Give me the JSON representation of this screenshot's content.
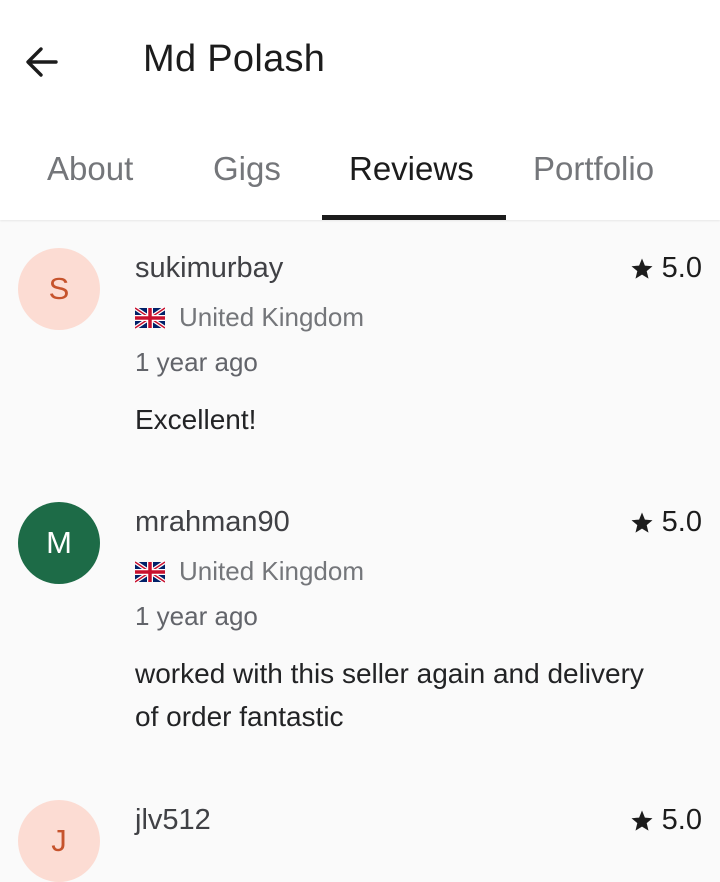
{
  "header": {
    "title": "Md Polash"
  },
  "tabs": [
    {
      "label": "About"
    },
    {
      "label": "Gigs"
    },
    {
      "label": "Reviews"
    },
    {
      "label": "Portfolio"
    }
  ],
  "active_tab": "Reviews",
  "reviews": [
    {
      "initial": "S",
      "avatar_bg": "#fcdcd3",
      "avatar_fg": "#c6532c",
      "username": "sukimurbay",
      "rating": "5.0",
      "country": "United Kingdom",
      "time": "1 year ago",
      "comment": "Excellent!"
    },
    {
      "initial": "M",
      "avatar_bg": "#1d6b47",
      "avatar_fg": "#ffffff",
      "username": "mrahman90",
      "rating": "5.0",
      "country": "United Kingdom",
      "time": "1 year ago",
      "comment": "worked with this seller again and delivery of order fantastic"
    },
    {
      "initial": "J",
      "avatar_bg": "#fcdcd3",
      "avatar_fg": "#c6532c",
      "username": "jlv512",
      "rating": "5.0"
    }
  ]
}
